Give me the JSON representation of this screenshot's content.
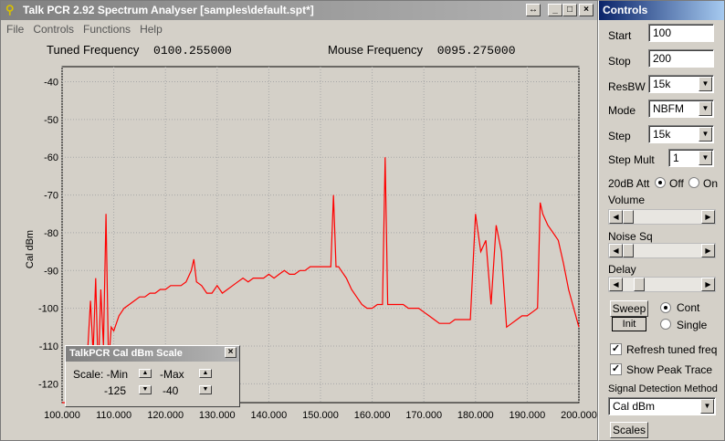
{
  "main_window": {
    "title": "Talk PCR 2.92 Spectrum Analyser [samples\\default.spt*]",
    "menu": [
      "File",
      "Controls",
      "Functions",
      "Help"
    ],
    "tuned_label": "Tuned Frequency",
    "tuned_value": "0100.255000",
    "mouse_label": "Mouse Frequency",
    "mouse_value": "0095.275000",
    "restore_glyph": "↔",
    "min_glyph": "_",
    "max_glyph": "□",
    "close_glyph": "×"
  },
  "chart_data": {
    "type": "line",
    "ylabel": "Cal dBm",
    "xlabel": "",
    "xlim": [
      100,
      200
    ],
    "ylim": [
      -125,
      -40
    ],
    "x_ticks": [
      "100.000",
      "110.000",
      "120.000",
      "130.000",
      "140.000",
      "150.000",
      "160.000",
      "170.000",
      "180.000",
      "190.000",
      "200.000"
    ],
    "y_ticks": [
      "-40",
      "-50",
      "-60",
      "-70",
      "-80",
      "-90",
      "-100",
      "-110",
      "-120"
    ],
    "grid": true,
    "series_color": "#ff0000",
    "x": [
      100.0,
      102.0,
      104.0,
      105.0,
      105.5,
      106.0,
      106.5,
      107.0,
      107.5,
      108.0,
      108.5,
      109.0,
      109.5,
      110.0,
      111.0,
      112.0,
      113.0,
      114.0,
      115.0,
      116.0,
      117.0,
      118.0,
      119.0,
      120.0,
      121.0,
      122.0,
      123.0,
      124.0,
      125.0,
      125.5,
      126.0,
      127.0,
      128.0,
      129.0,
      130.0,
      131.0,
      132.0,
      133.0,
      134.0,
      135.0,
      136.0,
      137.0,
      138.0,
      139.0,
      140.0,
      141.0,
      142.0,
      143.0,
      144.0,
      145.0,
      146.0,
      147.0,
      148.0,
      149.0,
      150.0,
      151.0,
      152.0,
      152.5,
      153.0,
      153.5,
      154.0,
      155.0,
      156.0,
      157.0,
      158.0,
      159.0,
      160.0,
      161.0,
      162.0,
      162.5,
      163.0,
      164.0,
      165.0,
      166.0,
      167.0,
      168.0,
      169.0,
      170.0,
      171.0,
      172.0,
      173.0,
      174.0,
      175.0,
      176.0,
      177.0,
      178.0,
      179.0,
      180.0,
      180.5,
      181.0,
      182.0,
      183.0,
      184.0,
      185.0,
      186.0,
      187.0,
      188.0,
      189.0,
      190.0,
      191.0,
      192.0,
      192.5,
      193.0,
      194.0,
      195.0,
      196.0,
      197.0,
      198.0,
      199.0,
      200.0
    ],
    "y": [
      -125,
      -125,
      -125,
      -110,
      -98,
      -112,
      -92,
      -118,
      -95,
      -110,
      -75,
      -115,
      -105,
      -106,
      -102,
      -100,
      -99,
      -98,
      -97,
      -97,
      -96,
      -96,
      -95,
      -95,
      -94,
      -94,
      -94,
      -93,
      -90,
      -87,
      -93,
      -94,
      -96,
      -96,
      -94,
      -96,
      -95,
      -94,
      -93,
      -92,
      -93,
      -92,
      -92,
      -92,
      -91,
      -92,
      -91,
      -90,
      -91,
      -91,
      -90,
      -90,
      -89,
      -89,
      -89,
      -89,
      -89,
      -70,
      -89,
      -89,
      -90,
      -92,
      -95,
      -97,
      -99,
      -100,
      -100,
      -99,
      -99,
      -60,
      -99,
      -99,
      -99,
      -99,
      -100,
      -100,
      -100,
      -101,
      -102,
      -103,
      -104,
      -104,
      -104,
      -103,
      -103,
      -103,
      -103,
      -75,
      -80,
      -85,
      -82,
      -99,
      -78,
      -85,
      -105,
      -104,
      -103,
      -102,
      -102,
      -101,
      -100,
      -72,
      -75,
      -78,
      -80,
      -82,
      -88,
      -95,
      -100,
      -105
    ]
  },
  "controls": {
    "title": "Controls",
    "start_label": "Start",
    "start_value": "100",
    "stop_label": "Stop",
    "stop_value": "200",
    "resbw_label": "ResBW",
    "resbw_value": "15k",
    "mode_label": "Mode",
    "mode_value": "NBFM",
    "step_label": "Step",
    "step_value": "15k",
    "stepmult_label": "Step Mult",
    "stepmult_value": "1",
    "att_label": "20dB Att",
    "att_off": "Off",
    "att_on": "On",
    "volume_label": "Volume",
    "noisesq_label": "Noise Sq",
    "delay_label": "Delay",
    "sweep_label": "Sweep",
    "init_label": "Init",
    "cont_label": "Cont",
    "single_label": "Single",
    "refresh_label": "Refresh tuned freq",
    "peak_label": "Show Peak Trace",
    "method_label": "Signal Detection Method",
    "method_value": "Cal dBm",
    "scales_label": "Scales",
    "arrow_down": "▼",
    "arrow_left": "◀",
    "arrow_right": "▶",
    "check_mark": "✓"
  },
  "scale_dialog": {
    "title": "TalkPCR Cal dBm Scale",
    "scale_label": "Scale: -Min",
    "max_label": "-Max",
    "min_value": "-125",
    "max_value": "-40",
    "close_glyph": "×",
    "up_glyph": "▲",
    "down_glyph": "▼"
  }
}
